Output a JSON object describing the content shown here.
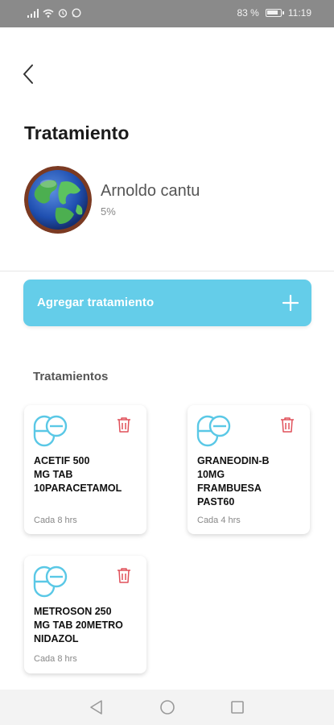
{
  "status_bar": {
    "battery_text": "83 %",
    "battery_level": 0.83,
    "time": "11:19",
    "icons": [
      "signal-icon",
      "wifi-icon",
      "alarm-icon",
      "whatsapp-icon"
    ]
  },
  "header": {
    "back_icon": "chevron-left-icon",
    "title": "Tratamiento"
  },
  "patient": {
    "avatar_icon": "globe-avatar",
    "name": "Arnoldo cantu",
    "progress": "5%"
  },
  "actions": {
    "add_label": "Agregar tratamiento",
    "add_icon": "plus-icon"
  },
  "section": {
    "title": "Tratamientos"
  },
  "treatments": [
    {
      "name": " ACETIF 500\nMG TAB\n10PARACETAMOL",
      "frequency": "Cada 8 hrs"
    },
    {
      "name": "GRANEODIN-B\n10MG\nFRAMBUESA\nPAST60",
      "frequency": "Cada 4 hrs"
    },
    {
      "name": " METROSON 250\nMG TAB 20METRO\nNIDAZOL",
      "frequency": "Cada 8 hrs"
    }
  ],
  "colors": {
    "accent": "#64cde9",
    "pill_stroke": "#5ac8e6",
    "trash": "#e0505a",
    "status_bar": "#8a8a8a"
  },
  "nav": {
    "icons": [
      "back-triangle-icon",
      "home-circle-icon",
      "recents-square-icon"
    ]
  }
}
